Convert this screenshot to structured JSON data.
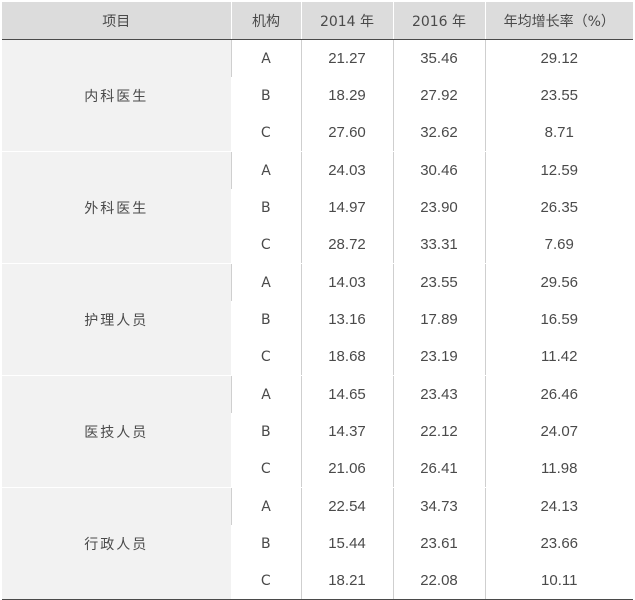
{
  "table": {
    "headers": [
      "项目",
      "机构",
      "2014 年",
      "2016 年",
      "年均增长率（%）"
    ],
    "groups": [
      {
        "item": "内科医生",
        "rows": [
          {
            "org": "A",
            "y2014": "21.27",
            "y2016": "35.46",
            "growth": "29.12"
          },
          {
            "org": "B",
            "y2014": "18.29",
            "y2016": "27.92",
            "growth": "23.55"
          },
          {
            "org": "C",
            "y2014": "27.60",
            "y2016": "32.62",
            "growth": "8.71"
          }
        ]
      },
      {
        "item": "外科医生",
        "rows": [
          {
            "org": "A",
            "y2014": "24.03",
            "y2016": "30.46",
            "growth": "12.59"
          },
          {
            "org": "B",
            "y2014": "14.97",
            "y2016": "23.90",
            "growth": "26.35"
          },
          {
            "org": "C",
            "y2014": "28.72",
            "y2016": "33.31",
            "growth": "7.69"
          }
        ]
      },
      {
        "item": "护理人员",
        "rows": [
          {
            "org": "A",
            "y2014": "14.03",
            "y2016": "23.55",
            "growth": "29.56"
          },
          {
            "org": "B",
            "y2014": "13.16",
            "y2016": "17.89",
            "growth": "16.59"
          },
          {
            "org": "C",
            "y2014": "18.68",
            "y2016": "23.19",
            "growth": "11.42"
          }
        ]
      },
      {
        "item": "医技人员",
        "rows": [
          {
            "org": "A",
            "y2014": "14.65",
            "y2016": "23.43",
            "growth": "26.46"
          },
          {
            "org": "B",
            "y2014": "14.37",
            "y2016": "22.12",
            "growth": "24.07"
          },
          {
            "org": "C",
            "y2014": "21.06",
            "y2016": "26.41",
            "growth": "11.98"
          }
        ]
      },
      {
        "item": "行政人员",
        "rows": [
          {
            "org": "A",
            "y2014": "22.54",
            "y2016": "34.73",
            "growth": "24.13"
          },
          {
            "org": "B",
            "y2014": "15.44",
            "y2016": "23.61",
            "growth": "23.66"
          },
          {
            "org": "C",
            "y2014": "18.21",
            "y2016": "22.08",
            "growth": "10.11"
          }
        ]
      }
    ]
  }
}
